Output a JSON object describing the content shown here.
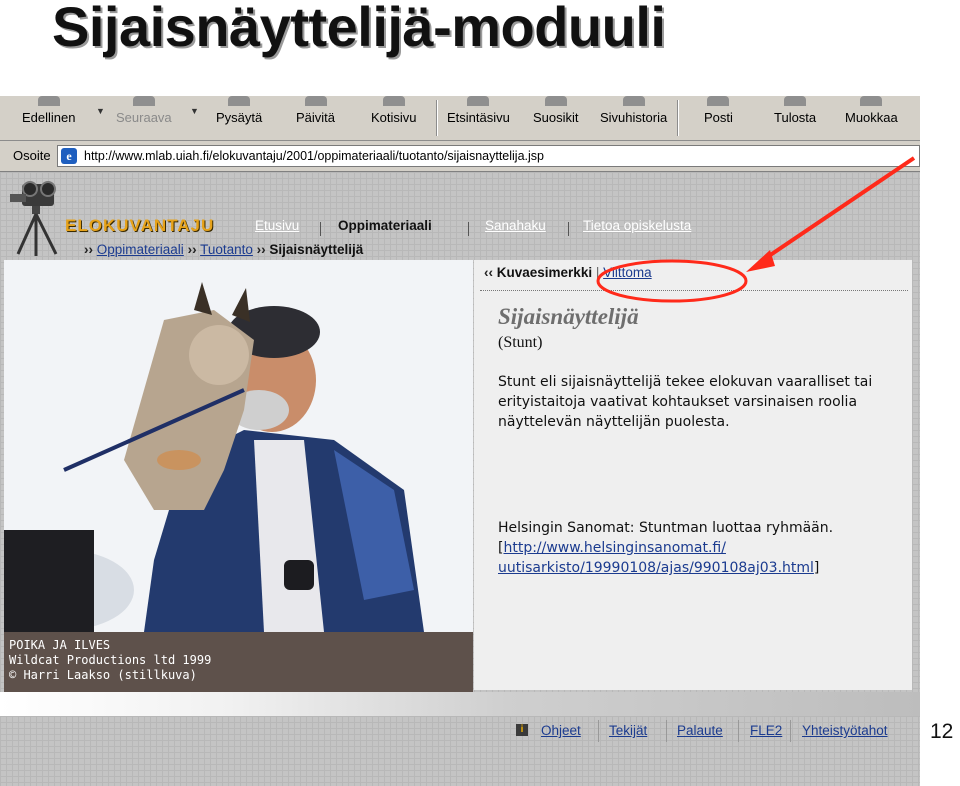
{
  "slide": {
    "title": "Sijaisnäyttelijä-moduuli",
    "page_number": "12"
  },
  "browser": {
    "toolbar": {
      "back": "Edellinen",
      "forward": "Seuraava",
      "stop": "Pysäytä",
      "refresh": "Päivitä",
      "home": "Kotisivu",
      "search": "Etsintäsivu",
      "favorites": "Suosikit",
      "history": "Sivuhistoria",
      "mail": "Posti",
      "print": "Tulosta",
      "edit": "Muokkaa"
    },
    "address": {
      "label": "Osoite",
      "url": "http://www.mlab.uiah.fi/elokuvantaju/2001/oppimateriaali/tuotanto/sijaisnayttelija.jsp"
    }
  },
  "site": {
    "logo": "ELOKUVANTAJU",
    "nav": {
      "home": "Etusivu",
      "materials": "Oppimateriaali",
      "wordsearch": "Sanahaku",
      "about": "Tietoa opiskelusta"
    },
    "breadcrumb": {
      "arrows": "››",
      "level1": "Oppimateriaali",
      "level2": "Tuotanto",
      "current": "Sijaisnäyttelijä"
    },
    "photo_caption": {
      "line1": "POIKA JA ILVES",
      "line2": "Wildcat Productions ltd 1999",
      "line3": "© Harri Laakso (stillkuva)"
    },
    "content": {
      "prev_arrows": "‹‹",
      "examples": "Kuvaesimerkki",
      "separator": "|",
      "sign_language": "Viittoma",
      "heading": "Sijaisnäyttelijä",
      "subheading": "(Stunt)",
      "body": "Stunt eli sijaisnäyttelijä tekee elokuvan vaaralliset tai erityistaitoja vaativat kohtaukset varsinaisen roolia näyttelevän näyttelijän puolesta.",
      "reference_text": "Helsingin Sanomat: Stuntman luottaa ryhmään.",
      "bracket_open": "[",
      "reference_link_1": "http://www.helsinginsanomat.fi/",
      "reference_link_2": "uutisarkisto/19990108/ajas/990108aj03.html",
      "bracket_close": "]"
    },
    "footer": {
      "help": "Ohjeet",
      "authors": "Tekijät",
      "feedback": "Palaute",
      "fle2": "FLE2",
      "contacts": "Yhteistyötahot"
    }
  },
  "annotation": {
    "color": "#ff2a1a"
  }
}
